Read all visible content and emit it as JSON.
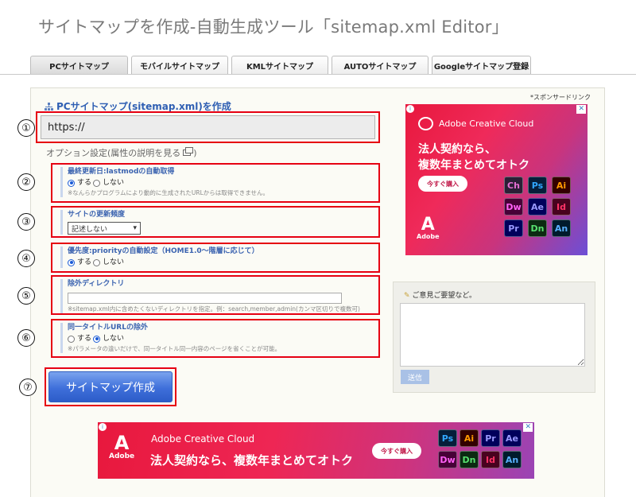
{
  "page": {
    "title": "サイトマップを作成-自動生成ツール「sitemap.xml Editor」"
  },
  "tabs": [
    {
      "label": "PCサイトマップ",
      "active": true
    },
    {
      "label": "モバイルサイトマップ",
      "active": false
    },
    {
      "label": "KMLサイトマップ",
      "active": false
    },
    {
      "label": "AUTOサイトマップ",
      "active": false
    },
    {
      "label": "Googleサイトマップ登録",
      "active": false
    }
  ],
  "sponsor_label": "*スポンサードリンク",
  "form": {
    "section_title": "PCサイトマップ(sitemap.xml)を作成",
    "url_value": "https://",
    "option_label": "オプション設定(属性の説明を見る",
    "option_label_close": ")",
    "lastmod": {
      "title": "最終更新日:lastmodの自動取得",
      "opt_yes": "する",
      "opt_no": "しない",
      "selected": "yes",
      "note": "※なんらかプログラムにより動的に生成されたURLからは取得できません。"
    },
    "changefreq": {
      "title": "サイトの更新頻度",
      "selected_option": "記述しない"
    },
    "priority": {
      "title": "優先度:priorityの自動設定（HOME1.0〜階層に応じて）",
      "opt_yes": "する",
      "opt_no": "しない",
      "selected": "yes"
    },
    "exclude_dir": {
      "title": "除外ディレクトリ",
      "value": "",
      "note": "※sitemap.xml内に含めたくないディレクトリを指定。例：search,member,admin(カンマ区切りで複数可)"
    },
    "same_title": {
      "title": "同一タイトルURLの除外",
      "opt_yes": "する",
      "opt_no": "しない",
      "selected": "no",
      "note": "※パラメータの違いだけで、同一タイトル同一内容のページを省くことが可能。"
    },
    "create_button": "サイトマップ作成"
  },
  "annotations": [
    "①",
    "②",
    "③",
    "④",
    "⑤",
    "⑥",
    "⑦"
  ],
  "ad_top": {
    "brand": "Adobe Creative Cloud",
    "copy_line1": "法人契約なら、",
    "copy_line2": "複数年まとめてオトク",
    "cta": "今すぐ購入",
    "logo_text": "Adobe",
    "close": "✕",
    "apps": [
      "Ch",
      "Ps",
      "Ai",
      "Dw",
      "Ae",
      "Id",
      "Pr",
      "Dn",
      "An"
    ]
  },
  "feedback": {
    "title": "ご意見ご要望など。",
    "text_value": "",
    "send_label": "送信"
  },
  "ad_bottom": {
    "brand": "Adobe Creative Cloud",
    "copy": "法人契約なら、複数年まとめてオトク",
    "cta": "今すぐ購入",
    "logo_text": "Adobe",
    "close": "✕",
    "apps": [
      "Ps",
      "Ai",
      "Pr",
      "Ae",
      "Dw",
      "Dn",
      "Id",
      "An"
    ]
  },
  "app_colors": {
    "Ch": [
      "#2b1f36",
      "#e56fd3"
    ],
    "Ps": [
      "#061e3a",
      "#31a8ff"
    ],
    "Ai": [
      "#330000",
      "#ff9a00"
    ],
    "Dw": [
      "#470137",
      "#ff61f6"
    ],
    "Ae": [
      "#00005b",
      "#9999ff"
    ],
    "Id": [
      "#49021f",
      "#ff3366"
    ],
    "Pr": [
      "#00005b",
      "#9999ff"
    ],
    "Dn": [
      "#0c2a12",
      "#58e06f"
    ],
    "An": [
      "#001b2d",
      "#59b1ff"
    ]
  }
}
